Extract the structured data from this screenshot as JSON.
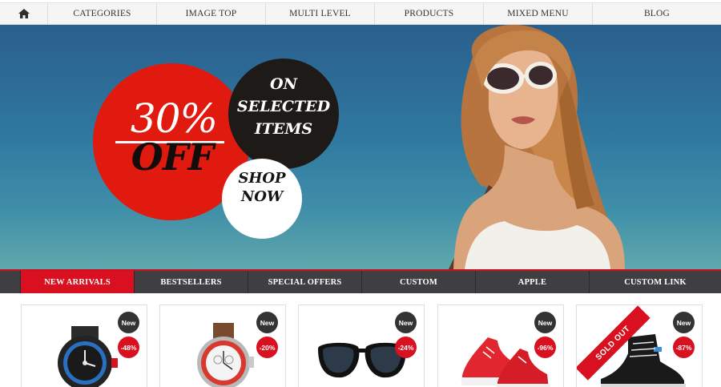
{
  "topnav": {
    "home_icon": "home-icon",
    "items": [
      "CATEGORIES",
      "IMAGE TOP",
      "MULTI LEVEL",
      "PRODUCTS",
      "MIXED MENU",
      "BLOG"
    ]
  },
  "hero": {
    "discount": "30%",
    "off": "OFF",
    "on_selected": [
      "ON",
      "SELECTED",
      "ITEMS"
    ],
    "shop_now": [
      "SHOP",
      "NOW"
    ]
  },
  "tabs": {
    "items": [
      "NEW ARRIVALS",
      "BESTSELLERS",
      "SPECIAL OFFERS",
      "CUSTOM",
      "APPLE",
      "CUSTOM LINK"
    ],
    "active": 0
  },
  "products": [
    {
      "image": "wristwatch-black",
      "badge_new": "New",
      "discount": "-48%"
    },
    {
      "image": "wristwatch-red-leather",
      "badge_new": "New",
      "discount": "-20%"
    },
    {
      "image": "sunglasses",
      "badge_new": "New",
      "discount": "-24%"
    },
    {
      "image": "red-sneakers",
      "badge_new": "New",
      "discount": "-96%"
    },
    {
      "image": "black-high-top-sneaker",
      "badge_new": "New",
      "discount": "-87%",
      "ribbon": "SOLD OUT"
    }
  ],
  "colors": {
    "accent_red": "#d8101f",
    "tab_bar": "#3f3f42",
    "hero_sky": "#2f78a0"
  }
}
